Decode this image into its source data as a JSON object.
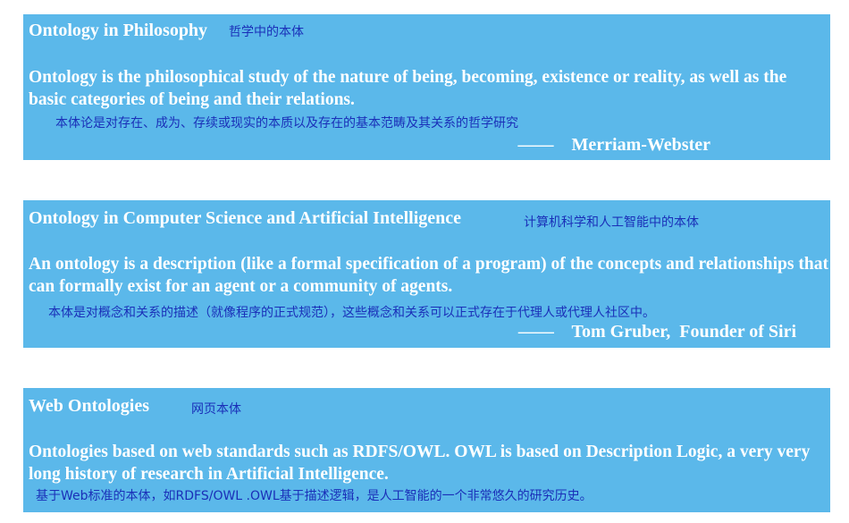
{
  "sections": [
    {
      "heading": "Ontology in Philosophy",
      "heading_cn": "哲学中的本体",
      "body": "Ontology is the philosophical study of the nature of being, becoming, existence or reality, as well as the basic categories of being and their relations.",
      "body_cn": "本体论是对存在、成为、存续或现实的本质以及存在的基本范畴及其关系的哲学研究",
      "attribution": "——    Merriam-Webster"
    },
    {
      "heading": "Ontology in Computer Science and Artificial Intelligence",
      "heading_cn": "计算机科学和人工智能中的本体",
      "body": "An ontology is a description (like a formal specification of a program) of the concepts and relationships that can formally exist for an agent or a community of agents.",
      "body_cn": "本体是对概念和关系的描述（就像程序的正式规范），这些概念和关系可以正式存在于代理人或代理人社区中。",
      "attribution": "——    Tom Gruber,  Founder of Siri"
    },
    {
      "heading": "Web Ontologies",
      "heading_cn": "网页本体",
      "body": "Ontologies based on web standards such as RDFS/OWL.  OWL is based on Description Logic, a very very long history of research in Artificial Intelligence.",
      "body_cn": "基于Web标准的本体，如RDFS/OWL .OWL基于描述逻辑，是人工智能的一个非常悠久的研究历史。"
    }
  ],
  "colors": {
    "box_background": "#5bb8ea",
    "english_text": "#ffffff",
    "chinese_text": "#1a2fb8"
  }
}
